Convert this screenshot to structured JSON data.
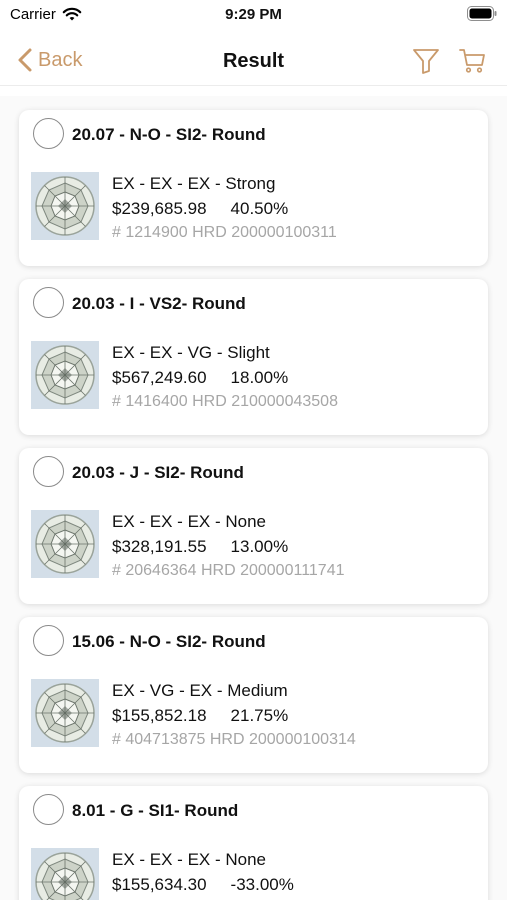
{
  "status_bar": {
    "carrier": "Carrier",
    "time": "9:29 PM"
  },
  "nav": {
    "back_label": "Back",
    "title": "Result",
    "accent_color": "#c99a6b"
  },
  "icons": {
    "back": "chevron-left-icon",
    "filter": "filter-icon",
    "cart": "cart-icon",
    "wifi": "wifi-icon",
    "battery": "battery-icon"
  },
  "results": [
    {
      "title": "20.07 - N-O - SI2- Round",
      "grades": "EX - EX - EX - Strong",
      "price": "$239,685.98",
      "percent": "40.50%",
      "cert": "# 1214900 HRD 200000100311",
      "selected": false
    },
    {
      "title": "20.03 - I - VS2- Round",
      "grades": "EX - EX - VG - Slight",
      "price": "$567,249.60",
      "percent": "18.00%",
      "cert": "# 1416400 HRD 210000043508",
      "selected": false
    },
    {
      "title": "20.03 - J - SI2- Round",
      "grades": "EX - EX - EX - None",
      "price": "$328,191.55",
      "percent": "13.00%",
      "cert": "# 20646364 HRD 200000111741",
      "selected": false
    },
    {
      "title": "15.06 - N-O - SI2- Round",
      "grades": "EX - VG - EX - Medium",
      "price": "$155,852.18",
      "percent": "21.75%",
      "cert": "# 404713875 HRD 200000100314",
      "selected": false
    },
    {
      "title": "8.01 - G - SI1- Round",
      "grades": "EX - EX - EX - None",
      "price": "$155,634.30",
      "percent": "-33.00%",
      "cert": "",
      "selected": false
    }
  ]
}
